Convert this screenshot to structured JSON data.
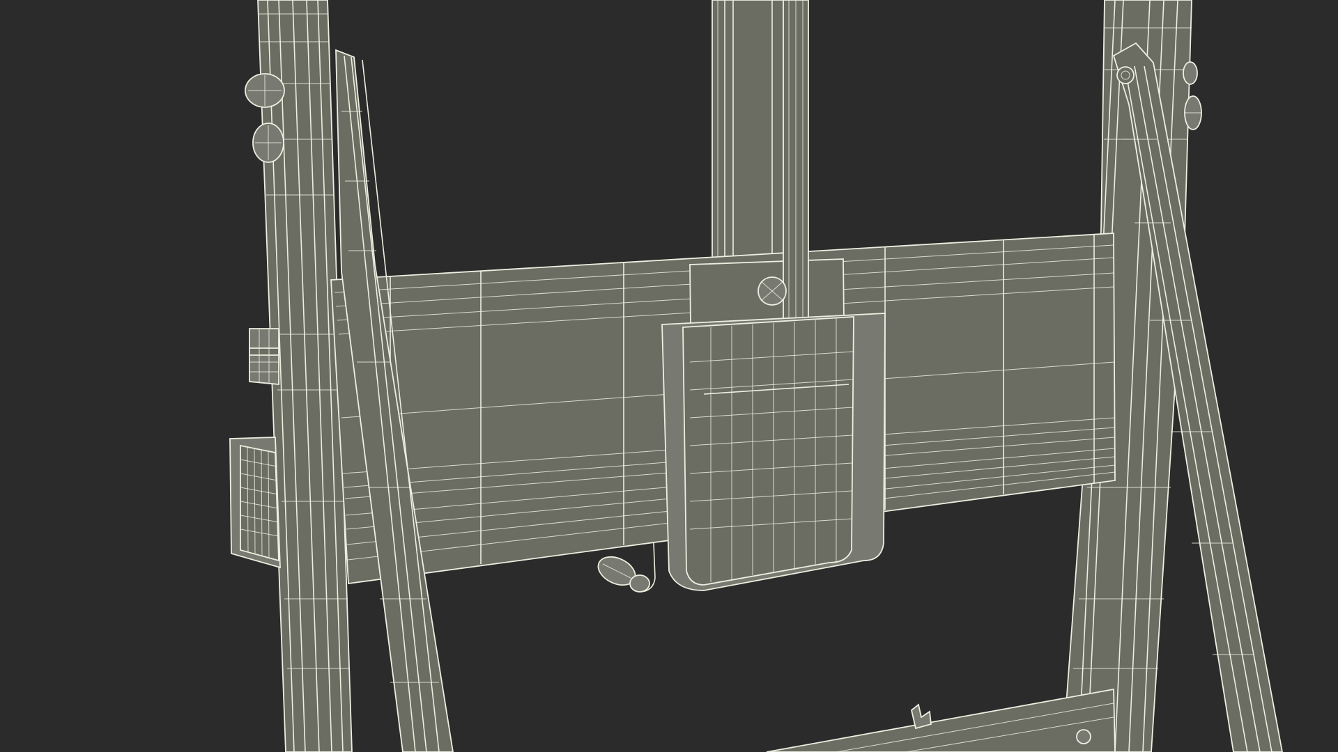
{
  "scene": {
    "background": "#2b2b2b",
    "material_fill": "#6b6c62",
    "material_fill_light": "#7a7b70",
    "material_fill_dark": "#5a5b52",
    "wire_color": "#ecefe0"
  },
  "objects": [
    "left-rear-leg",
    "left-diagonal-brace",
    "center-mast",
    "horizontal-crossbar",
    "canvas-clamp-block",
    "right-rear-leg",
    "right-diagonal-brace",
    "left-small-shelf",
    "left-drawer-box",
    "crank-handle",
    "wing-nut",
    "bottom-crossbar",
    "knob-upper-left",
    "knob-upper-right"
  ]
}
